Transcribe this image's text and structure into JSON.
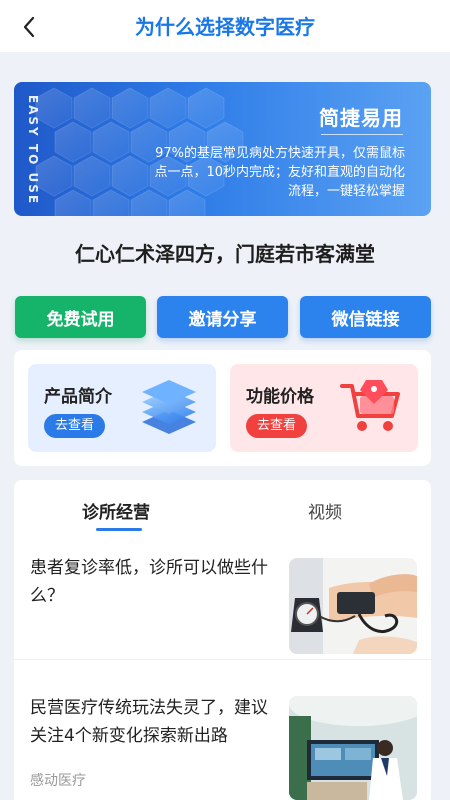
{
  "header": {
    "title": "为什么选择数字医疗",
    "back_icon": "chevron-left-icon"
  },
  "banner": {
    "vertical_text": "EASY TO USE",
    "heading": "简捷易用",
    "body": "97%的基层常见病处方快速开具，仅需鼠标点一点，10秒内完成；友好和直观的自动化流程，一键轻松掌握",
    "active_slide": 1,
    "slide_count": 3
  },
  "slogan": "仁心仁术泽四方，门庭若市客满堂",
  "actions": [
    {
      "label": "免费试用",
      "color": "#16b36b"
    },
    {
      "label": "邀请分享",
      "color": "#2c83ee"
    },
    {
      "label": "微信链接",
      "color": "#2c83ee"
    }
  ],
  "cards": [
    {
      "title": "产品简介",
      "button": "去查看",
      "icon": "layers-icon",
      "bg": "#e6efff"
    },
    {
      "title": "功能价格",
      "button": "去查看",
      "icon": "shopping-cart-icon",
      "bg": "#ffe6e8"
    }
  ],
  "tabs": [
    {
      "label": "诊所经营",
      "active": true
    },
    {
      "label": "视频",
      "active": false
    }
  ],
  "articles": [
    {
      "title": "患者复诊率低，诊所可以做些什么？",
      "source": "",
      "image": "blood-pressure-photo"
    },
    {
      "title": "民营医疗传统玩法失灵了，建议关注4个新变化探索新出路",
      "source": "感动医疗",
      "image": "clinic-photo"
    }
  ],
  "colors": {
    "accent": "#2a7be8",
    "title": "#1a78e6",
    "green": "#16b36b",
    "red": "#f0413f"
  }
}
